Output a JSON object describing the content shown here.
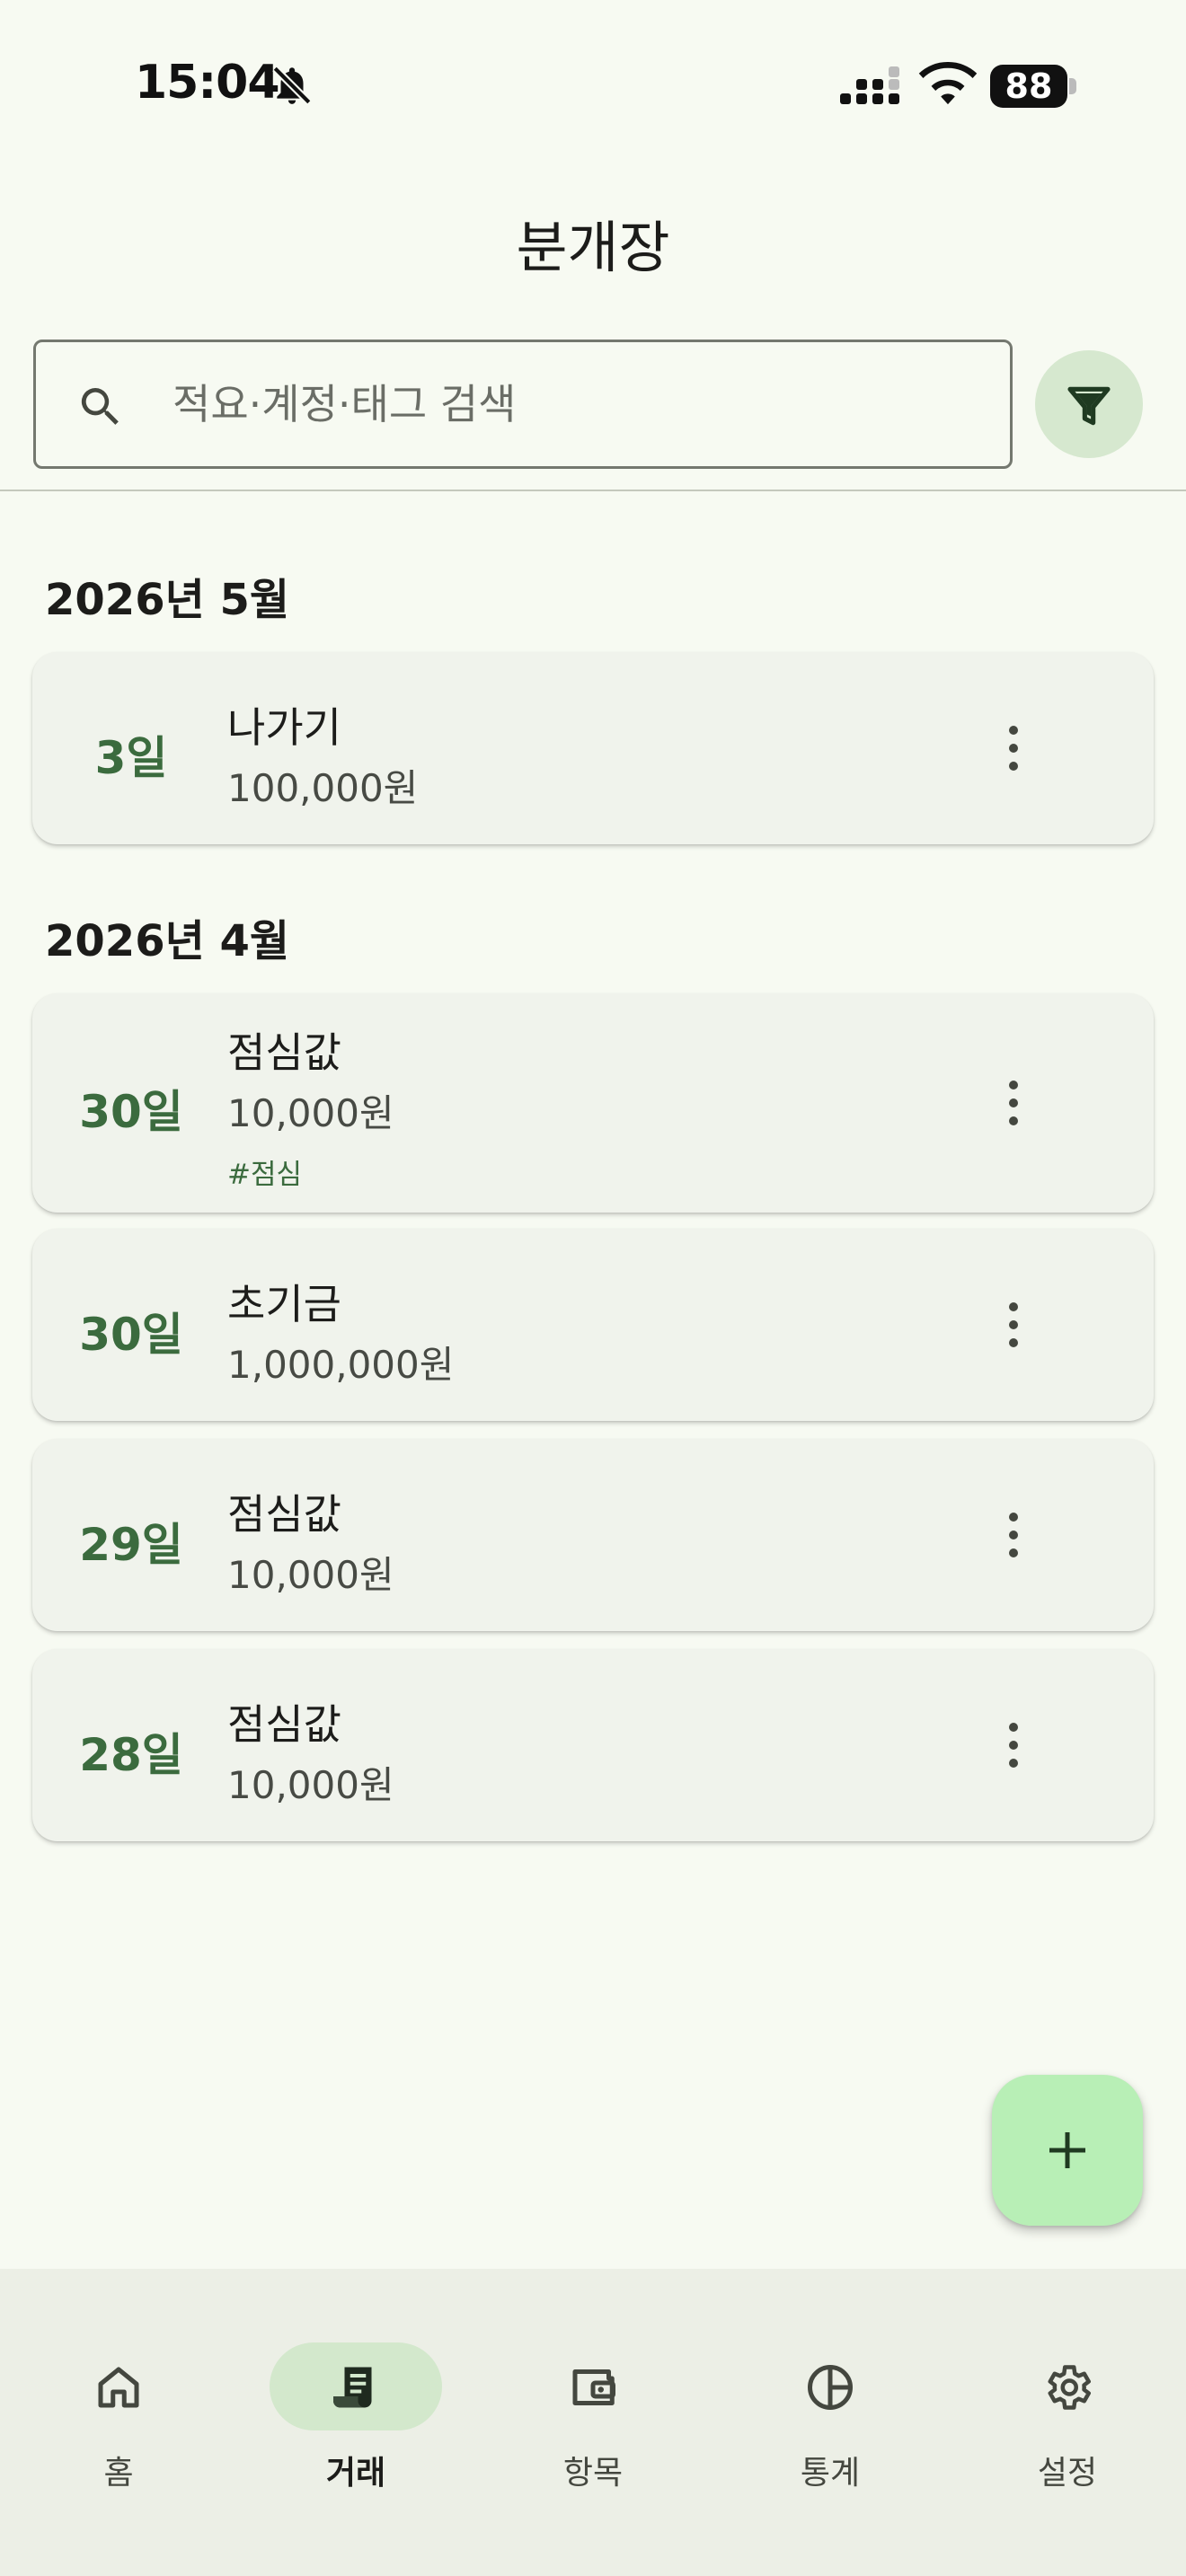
{
  "status_bar": {
    "time": "15:04",
    "battery": "88"
  },
  "header": {
    "title": "분개장"
  },
  "search": {
    "placeholder": "적요·계정·태그 검색"
  },
  "sections": [
    {
      "month": "2026년 5월",
      "entries": [
        {
          "day": "3일",
          "title": "나가기",
          "amount": "100,000원",
          "tag": ""
        }
      ]
    },
    {
      "month": "2026년 4월",
      "entries": [
        {
          "day": "30일",
          "title": "점심값",
          "amount": "10,000원",
          "tag": "#점심"
        },
        {
          "day": "30일",
          "title": "초기금",
          "amount": "1,000,000원",
          "tag": ""
        },
        {
          "day": "29일",
          "title": "점심값",
          "amount": "10,000원",
          "tag": ""
        },
        {
          "day": "28일",
          "title": "점심값",
          "amount": "10,000원",
          "tag": ""
        }
      ]
    }
  ],
  "nav": {
    "items": [
      {
        "label": "홈",
        "icon": "home-icon",
        "active": false
      },
      {
        "label": "거래",
        "icon": "receipt-icon",
        "active": true
      },
      {
        "label": "항목",
        "icon": "wallet-icon",
        "active": false
      },
      {
        "label": "통계",
        "icon": "pie-chart-icon",
        "active": false
      },
      {
        "label": "설정",
        "icon": "gear-icon",
        "active": false
      }
    ]
  },
  "colors": {
    "background": "#f7faf2",
    "accent": "#3b6b3e",
    "card": "#f0f3ec",
    "fab": "#b8efb6",
    "nav_active": "#d3e8cc"
  }
}
